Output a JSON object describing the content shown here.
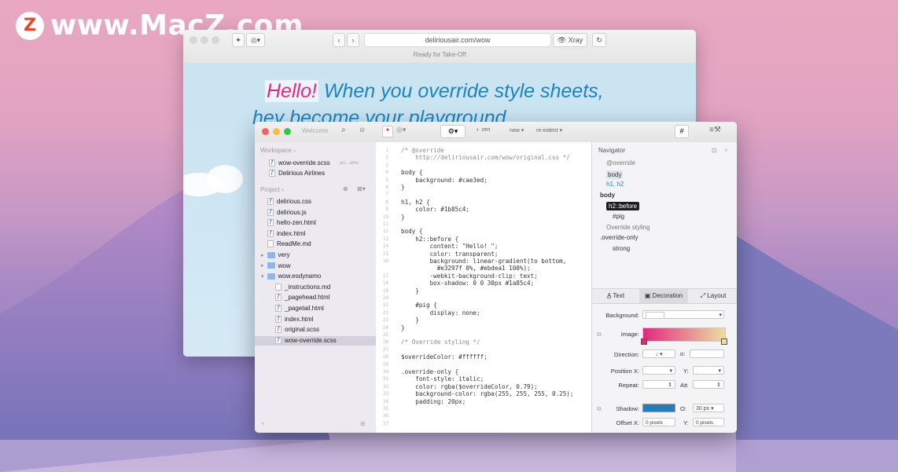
{
  "watermark": {
    "logo_letter": "Z",
    "text": "www.MacZ.com"
  },
  "safari": {
    "url": "deliriousair.com/wow",
    "xray_label": "Xray",
    "status": "Ready for Take-Off",
    "headline_word": "Hello!",
    "headline_rest": " When you override style sheets,",
    "headline_line2": "hey become your playground"
  },
  "editor": {
    "welcome": "Welcome",
    "toolbar": {
      "zen": "zen",
      "new": "new",
      "reindent": "re-indent",
      "hash": "#"
    },
    "sidebar": {
      "workspace_label": "Workspace",
      "workspace_items": [
        {
          "name": "wow-override.scss",
          "meta": "wo...amo"
        },
        {
          "name": "Delirious Airlines",
          "meta": ""
        }
      ],
      "project_label": "Project",
      "project_items": [
        {
          "name": "delirious.css",
          "kind": "file",
          "depth": 0
        },
        {
          "name": "delirious.js",
          "kind": "file",
          "depth": 0
        },
        {
          "name": "hello-zen.html",
          "kind": "file",
          "depth": 0
        },
        {
          "name": "index.html",
          "kind": "file",
          "depth": 0
        },
        {
          "name": "ReadMe.md",
          "kind": "doc",
          "depth": 0
        },
        {
          "name": "very",
          "kind": "folder",
          "depth": 0
        },
        {
          "name": "wow",
          "kind": "folder",
          "depth": 0
        },
        {
          "name": "wow.esdynamo",
          "kind": "folder-open",
          "depth": 0
        },
        {
          "name": "_instructions.md",
          "kind": "doc",
          "depth": 1
        },
        {
          "name": "_pagehead.html",
          "kind": "file",
          "depth": 1
        },
        {
          "name": "_pagetail.html",
          "kind": "file",
          "depth": 1
        },
        {
          "name": "index.html",
          "kind": "file",
          "depth": 1
        },
        {
          "name": "original.scss",
          "kind": "file",
          "depth": 1
        },
        {
          "name": "wow-override.scss",
          "kind": "file",
          "depth": 1
        }
      ]
    },
    "code_lines": [
      {
        "n": "1",
        "t": "/* @override",
        "c": "cm"
      },
      {
        "n": "2",
        "t": "    http://deliriousair.com/wow/original.css */",
        "c": "cm"
      },
      {
        "n": "3",
        "t": "",
        "c": ""
      },
      {
        "n": "4",
        "t": "body {",
        "c": ""
      },
      {
        "n": "5",
        "t": "    background: #cae3ed;",
        "c": ""
      },
      {
        "n": "6",
        "t": "}",
        "c": ""
      },
      {
        "n": "7",
        "t": "",
        "c": ""
      },
      {
        "n": "8",
        "t": "h1, h2 {",
        "c": ""
      },
      {
        "n": "9",
        "t": "    color: #1b85c4;",
        "c": ""
      },
      {
        "n": "10",
        "t": "}",
        "c": ""
      },
      {
        "n": "11",
        "t": "",
        "c": ""
      },
      {
        "n": "12",
        "t": "body {",
        "c": ""
      },
      {
        "n": "13",
        "t": "    h2::before {",
        "c": ""
      },
      {
        "n": "14",
        "t": "        content: \"Hello! \";",
        "c": ""
      },
      {
        "n": "15",
        "t": "        color: transparent;",
        "c": ""
      },
      {
        "n": "16",
        "t": "        background: linear-gradient(to bottom,",
        "c": ""
      },
      {
        "n": "",
        "t": "          #e3297f 0%, #ebdea1 100%);",
        "c": ""
      },
      {
        "n": "17",
        "t": "        -webkit-background-clip: text;",
        "c": ""
      },
      {
        "n": "18",
        "t": "        box-shadow: 0 0 30px #1a85c4;",
        "c": ""
      },
      {
        "n": "19",
        "t": "    }",
        "c": ""
      },
      {
        "n": "20",
        "t": "",
        "c": ""
      },
      {
        "n": "21",
        "t": "    #pig {",
        "c": ""
      },
      {
        "n": "22",
        "t": "        display: none;",
        "c": ""
      },
      {
        "n": "23",
        "t": "    }",
        "c": ""
      },
      {
        "n": "24",
        "t": "}",
        "c": ""
      },
      {
        "n": "25",
        "t": "",
        "c": ""
      },
      {
        "n": "26",
        "t": "/* Override styling */",
        "c": "cm"
      },
      {
        "n": "27",
        "t": "",
        "c": ""
      },
      {
        "n": "28",
        "t": "$overrideColor: #ffffff;",
        "c": ""
      },
      {
        "n": "29",
        "t": "",
        "c": ""
      },
      {
        "n": "30",
        "t": ".override-only {",
        "c": ""
      },
      {
        "n": "31",
        "t": "    font-style: italic;",
        "c": ""
      },
      {
        "n": "32",
        "t": "    color: rgba($overrideColor, 0.79);",
        "c": ""
      },
      {
        "n": "33",
        "t": "    background-color: rgba(255, 255, 255, 0.25);",
        "c": ""
      },
      {
        "n": "34",
        "t": "    padding: 20px;",
        "c": ""
      },
      {
        "n": "35",
        "t": "",
        "c": ""
      },
      {
        "n": "36",
        "t": "",
        "c": ""
      },
      {
        "n": "37",
        "t": "",
        "c": ""
      }
    ],
    "navigator": {
      "title": "Navigator",
      "items": [
        {
          "t": "@override",
          "indent": 1,
          "style": "muted"
        },
        {
          "t": "body",
          "indent": 1,
          "style": "chip"
        },
        {
          "t": "h1, h2",
          "indent": 1,
          "style": "blue"
        },
        {
          "t": "body",
          "indent": 0,
          "style": "bold"
        },
        {
          "t": "h2::before",
          "indent": 1,
          "style": "selected"
        },
        {
          "t": "#pig",
          "indent": 2,
          "style": ""
        },
        {
          "t": "Override styling",
          "indent": 1,
          "style": "muted"
        },
        {
          "t": ".override-only",
          "indent": 0,
          "style": ""
        },
        {
          "t": "strong",
          "indent": 2,
          "style": ""
        }
      ]
    },
    "inspector": {
      "tabs": [
        "Text",
        "Decoration",
        "Layout"
      ],
      "background_label": "Background:",
      "image_label": "Image:",
      "direction_label": "Direction:",
      "direction_value": "↓",
      "degree_symbol": "o:",
      "position_x_label": "Position X:",
      "y_label": "Y:",
      "repeat_label": "Repeat:",
      "att_label": "Att",
      "shadow_label": "Shadow:",
      "shadow_color": "#1f7fc2",
      "blur_symbol": "O:",
      "shadow_blur": "30 px",
      "offset_x_label": "Offset X:",
      "offset_x_value": "0 pixels",
      "offset_y_value": "0 pixels"
    }
  }
}
